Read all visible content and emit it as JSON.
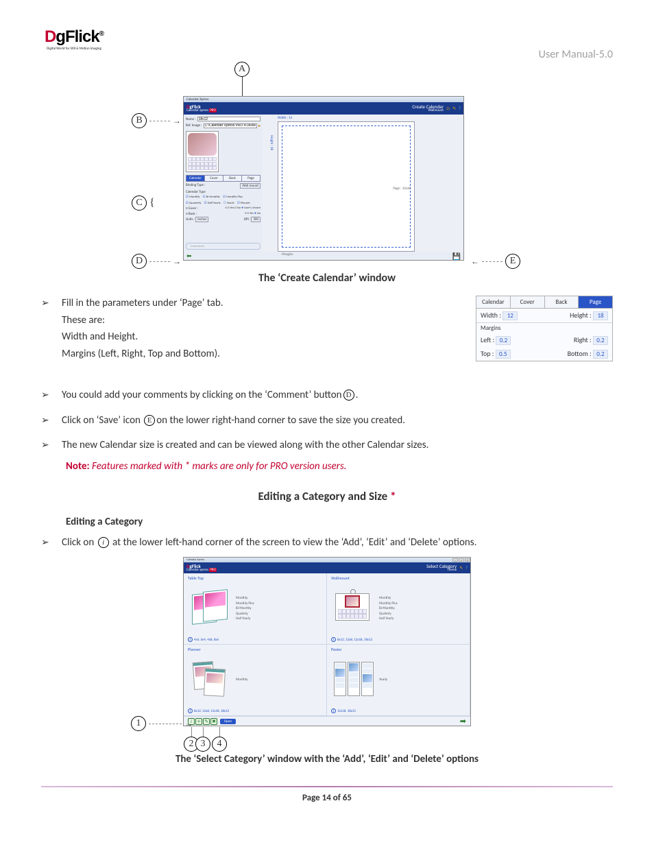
{
  "header": {
    "logo_main": "DgFlick",
    "logo_sub": "Digital World for Still & Motion Imaging",
    "user_manual": "User Manual-5.0"
  },
  "figure1": {
    "labels": {
      "A": "A",
      "B": "B",
      "C": "C",
      "D": "D",
      "E": "E"
    },
    "caption": "The ‘Create Calendar’ window",
    "shot": {
      "win_title": "Calendar Xpress",
      "brand_title": "DgFlick",
      "brand_sub": "Calendar xpress",
      "brand_tag": "PRO",
      "header_right": "Create Calendar",
      "header_right_sub": "Wallmount",
      "name_label": "Name :",
      "name_value": "18x12",
      "ref_label": "Ref. Image :",
      "ref_value": "C:\\Calendar Xpress PRO 4.0\\Res...",
      "tabs": [
        "Calendar",
        "Cover",
        "Back",
        "Page"
      ],
      "binding_label": "Binding Type :",
      "binding_value": "Wall mount",
      "caltype_label": "Calendar Type",
      "caltype_opts": [
        "Monthly",
        "Bi-Monthly",
        "Monthly Plus",
        "Quarterly",
        "Half Yearly",
        "Yearly",
        "Planner"
      ],
      "cover_label": "Cover :",
      "cover_opts": [
        "Yes",
        "No",
        "User's choice"
      ],
      "back_label": "Back :",
      "back_opts": [
        "Yes",
        "No"
      ],
      "units_label": "Units :",
      "units_value": "Inches",
      "dpi_label": "DPI :",
      "dpi_value": "300",
      "comment_ph": "Comments",
      "canvas": {
        "width_lbl": "Width : 12",
        "height_lbl": "Height : 18",
        "page_lbl": "Page : 12x18",
        "margin_lbl": "Margins"
      }
    }
  },
  "page_tab": {
    "tabs": [
      "Calendar",
      "Cover",
      "Back",
      "Page"
    ],
    "width_label": "Width :",
    "width_val": "12",
    "height_label": "Height :",
    "height_val": "18",
    "margins_label": "Margins",
    "left_label": "Left :",
    "left_val": "0.2",
    "right_label": "Right :",
    "right_val": "0.2",
    "top_label": "Top :",
    "top_val": "0.5",
    "bottom_label": "Bottom :",
    "bottom_val": "0.2"
  },
  "bullets": {
    "b1_l1": "Fill in the parameters under ‘Page’ tab.",
    "b1_l2": "These are:",
    "b1_l3": "Width and Height.",
    "b1_l4": "Margins (Left, Right, Top and Bottom).",
    "b2_a": "You could add your comments by clicking on the ‘Comment’ button",
    "b2_b": ".",
    "b3_a": "Click on ‘Save’ icon ",
    "b3_b": "on the lower right-hand corner to save the size you created.",
    "b4": "The new Calendar size is created and can be viewed along with the other Calendar sizes.",
    "b5": "at the lower left-hand corner of the screen to view the ‘Add’, ‘Edit’ and ‘Delete’ options.",
    "b5_pre": "Click on "
  },
  "note": {
    "lead": "Note:",
    "text": " Features marked with * marks are only for PRO version users."
  },
  "h3": {
    "text": "Editing a Category and Size ",
    "star": "*"
  },
  "subh": "Editing a Category",
  "figure2": {
    "labels": {
      "n1": "1",
      "n2": "2",
      "n3": "3",
      "n4": "4"
    },
    "caption": "The ‘Select Category’ window with the ‘Add’, ‘Edit’ and ‘Delete’ options",
    "shot": {
      "win_title": "Calendar Xpress",
      "brand_title": "DgFlick",
      "brand_sub": "Calendar xpress",
      "brand_tag": "PRO",
      "header_right": "Select Category",
      "header_right_sub": "Theme",
      "cats": [
        {
          "title": "Table Top",
          "types": [
            "Monthly",
            "Monthly Plus",
            "Bi-Monthly",
            "Quaterly",
            "Half Yearly"
          ],
          "sizes": "4x6, 6x4, 4x8, 8x6"
        },
        {
          "title": "Wallmount",
          "types": [
            "Monthly",
            "Monthly Plus",
            "Bi-Monthly",
            "Quaterly",
            "Half Yearly"
          ],
          "sizes": "8x12, 12x8, 12x18, 18x12"
        },
        {
          "title": "Planner",
          "types": [
            "Monthly"
          ],
          "sizes": "8x12, 12x8, 12x18, 18x12"
        },
        {
          "title": "Poster",
          "types": [
            "Yearly"
          ],
          "sizes": "12x18, 18x12"
        }
      ],
      "open": "Open"
    }
  },
  "inline_labels": {
    "D": "D",
    "E": "E",
    "i": "i"
  },
  "footer": {
    "page_a": "Page ",
    "page_b": "14",
    "page_c": " of ",
    "page_d": "65"
  }
}
